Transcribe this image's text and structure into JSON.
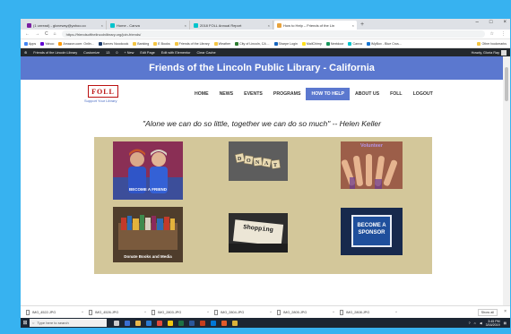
{
  "browser": {
    "tabs": [
      {
        "title": "(1 unread) - glcnewsy@yahoo.co",
        "color": "#7b1fa2",
        "active": false
      },
      {
        "title": "Home - Canva",
        "color": "#00c4cc",
        "active": false
      },
      {
        "title": "2018 FOLL Annual Report",
        "color": "#00c4cc",
        "active": false
      },
      {
        "title": "How to Help – Friends of the Lin",
        "color": "#e8a33d",
        "active": true
      }
    ],
    "new_tab": "+",
    "window_controls": {
      "minimize": "–",
      "maximize": "□",
      "close": "×"
    },
    "url": "https://friendsofthelincolnlibrary.org/join-friends/",
    "nav": {
      "back": "←",
      "forward": "→",
      "reload": "C",
      "home": "⌂"
    },
    "bookmarks": [
      {
        "label": "Apps",
        "color": "#4285f4"
      },
      {
        "label": "Yahoo",
        "color": "#6001d2"
      },
      {
        "label": "Amazon.com: Onlin...",
        "color": "#ff9900"
      },
      {
        "label": "Barnes Noodcook",
        "color": "#1a3a6b"
      },
      {
        "label": "Banking",
        "color": "#f4c542"
      },
      {
        "label": "E Books",
        "color": "#f4c542"
      },
      {
        "label": "Friends of the Library",
        "color": "#f4c542"
      },
      {
        "label": "Weather",
        "color": "#f4c542"
      },
      {
        "label": "City of Lincoln, CA ...",
        "color": "#2e7d32"
      },
      {
        "label": "Sharpe Login",
        "color": "#1565c0"
      },
      {
        "label": "MailChimp",
        "color": "#ffe01b"
      },
      {
        "label": "Nextdoor",
        "color": "#19975d"
      },
      {
        "label": "Canva",
        "color": "#00c4cc"
      },
      {
        "label": "IMyBox - Blue Crus...",
        "color": "#1976d2"
      }
    ],
    "other_bookmarks": "Other bookmarks"
  },
  "adminbar": {
    "items": [
      "Friends of the Lincoln Library",
      "Customize",
      "13",
      "0",
      "+ New",
      "Edit Page",
      "Edit with Elementor",
      "Clear Cache"
    ],
    "greeting": "Howdy, Gloria Ray"
  },
  "site": {
    "title": "Friends of the Lincoln Public Library - California",
    "logo_text": "FOLL",
    "logo_tagline": "Support Your Library",
    "nav": [
      {
        "label": "HOME",
        "active": false
      },
      {
        "label": "NEWS",
        "active": false
      },
      {
        "label": "EVENTS",
        "active": false
      },
      {
        "label": "PROGRAMS",
        "active": false
      },
      {
        "label": "HOW TO HELP",
        "active": true
      },
      {
        "label": "ABOUT US",
        "active": false
      },
      {
        "label": "FOLL",
        "active": false
      },
      {
        "label": "LOGOUT",
        "active": false
      }
    ],
    "quote": "\"Alone we can do so little, together we can do so much\" -- Helen Keller",
    "tiles": {
      "become_friend": "BECOME A FRIEND",
      "donate": "DONATE",
      "volunteer": "Volunteer",
      "donate_books": "Donate Books and Media",
      "shopping": "Shopping",
      "sponsor": "BECOME A SPONSOR"
    }
  },
  "downloads": {
    "files": [
      "IMG_4522.JPG",
      "IMG_4526.JPG",
      "IMG_2803.JPG",
      "IMG_2804.JPG",
      "IMG_2805.JPG",
      "IMG_2808.JPG"
    ],
    "show_all": "Show all",
    "close": "×"
  },
  "taskbar": {
    "search_placeholder": "Type here to search",
    "time": "3:45 PM",
    "date": "3/16/2019"
  }
}
